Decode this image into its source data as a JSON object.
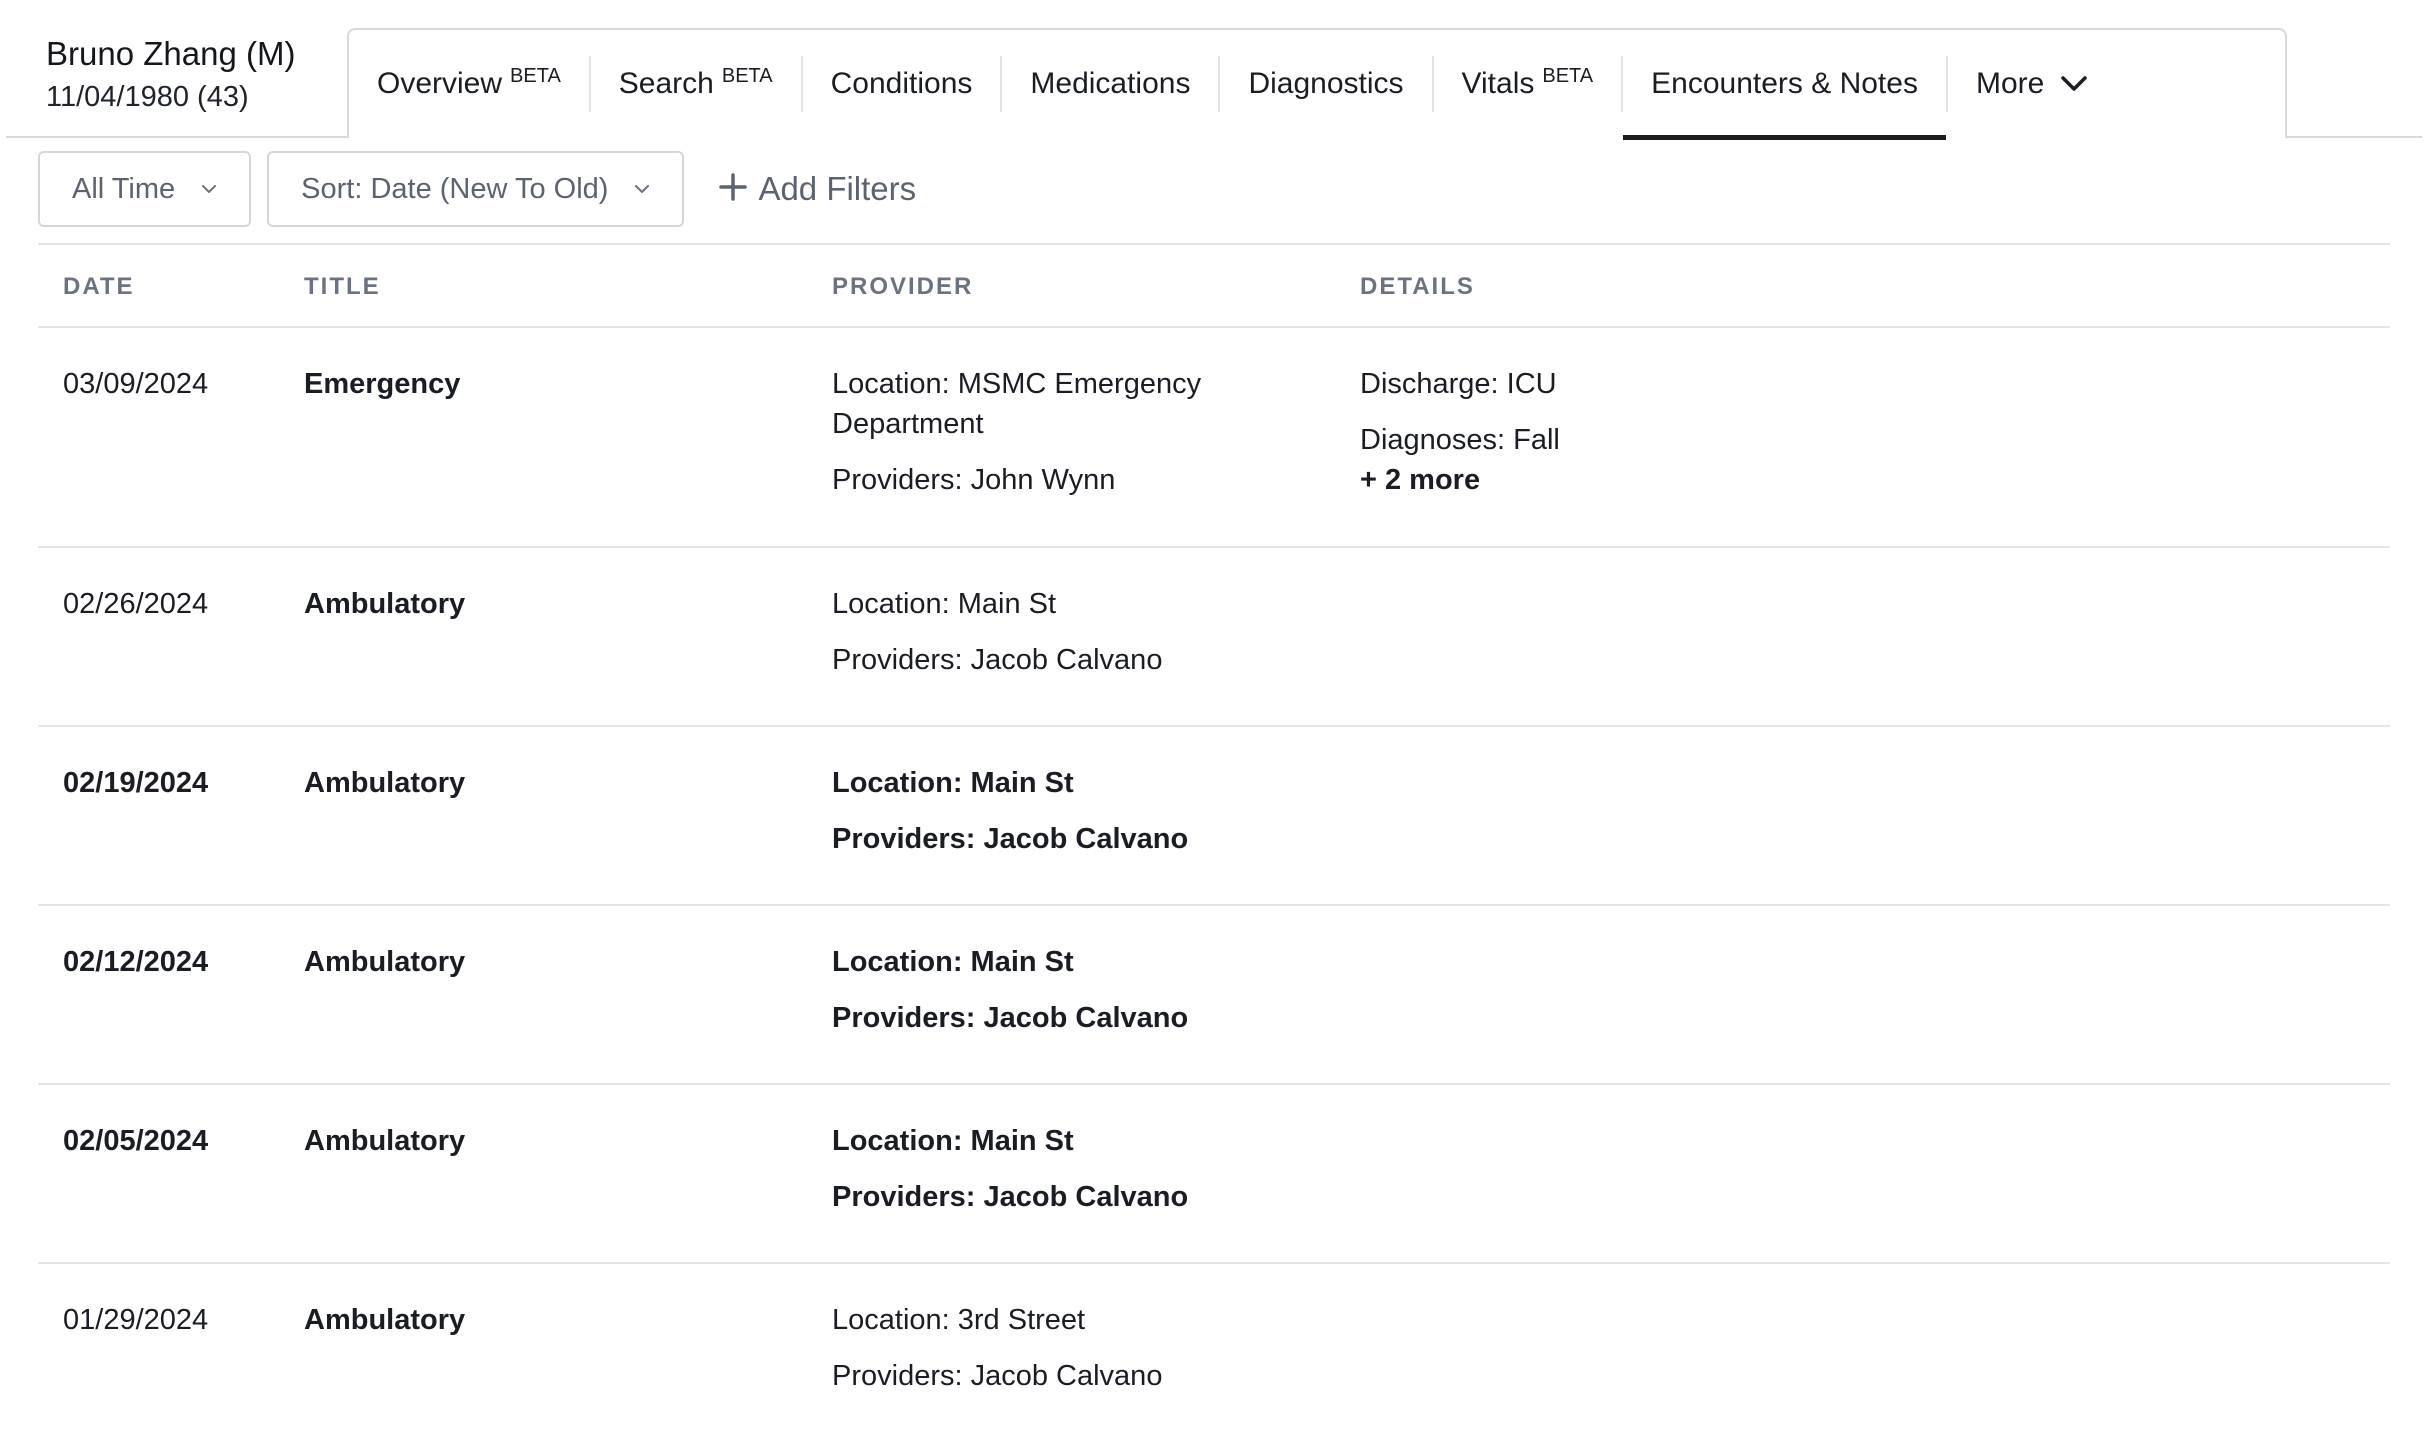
{
  "patient": {
    "name": "Bruno Zhang (M)",
    "dob": "11/04/1980 (43)"
  },
  "tabs": [
    {
      "label": "Overview",
      "badge": "BETA"
    },
    {
      "label": "Search",
      "badge": "BETA"
    },
    {
      "label": "Conditions",
      "badge": ""
    },
    {
      "label": "Medications",
      "badge": ""
    },
    {
      "label": "Diagnostics",
      "badge": ""
    },
    {
      "label": "Vitals",
      "badge": "BETA"
    },
    {
      "label": "Encounters & Notes",
      "badge": ""
    },
    {
      "label": "More",
      "badge": ""
    }
  ],
  "active_tab": "Encounters & Notes",
  "filters": {
    "time_range": "All Time",
    "sort": "Sort: Date (New To Old)",
    "add_filters": "Add Filters"
  },
  "table": {
    "headers": {
      "date": "DATE",
      "title": "TITLE",
      "provider": "PROVIDER",
      "details": "DETAILS"
    },
    "rows": [
      {
        "date": "03/09/2024",
        "title": "Emergency",
        "location": "Location: MSMC Emergency Department",
        "providers": "Providers: John Wynn",
        "discharge": "Discharge: ICU",
        "diagnoses": "Diagnoses: Fall",
        "more": "+ 2 more",
        "unread": false
      },
      {
        "date": "02/26/2024",
        "title": "Ambulatory",
        "location": "Location: Main St",
        "providers": "Providers: Jacob Calvano",
        "unread": false
      },
      {
        "date": "02/19/2024",
        "title": "Ambulatory",
        "location": "Location: Main St",
        "providers": "Providers: Jacob Calvano",
        "unread": true
      },
      {
        "date": "02/12/2024",
        "title": "Ambulatory",
        "location": "Location: Main St",
        "providers": "Providers: Jacob Calvano",
        "unread": true
      },
      {
        "date": "02/05/2024",
        "title": "Ambulatory",
        "location": "Location: Main St",
        "providers": "Providers: Jacob Calvano",
        "unread": true
      },
      {
        "date": "01/29/2024",
        "title": "Ambulatory",
        "location": "Location: 3rd Street",
        "providers": "Providers: Jacob Calvano",
        "unread": false
      }
    ]
  },
  "icons": {
    "more_tab": "chevron-down-icon",
    "dropdown": "chevron-down-icon",
    "add_filters": "plus-icon"
  }
}
